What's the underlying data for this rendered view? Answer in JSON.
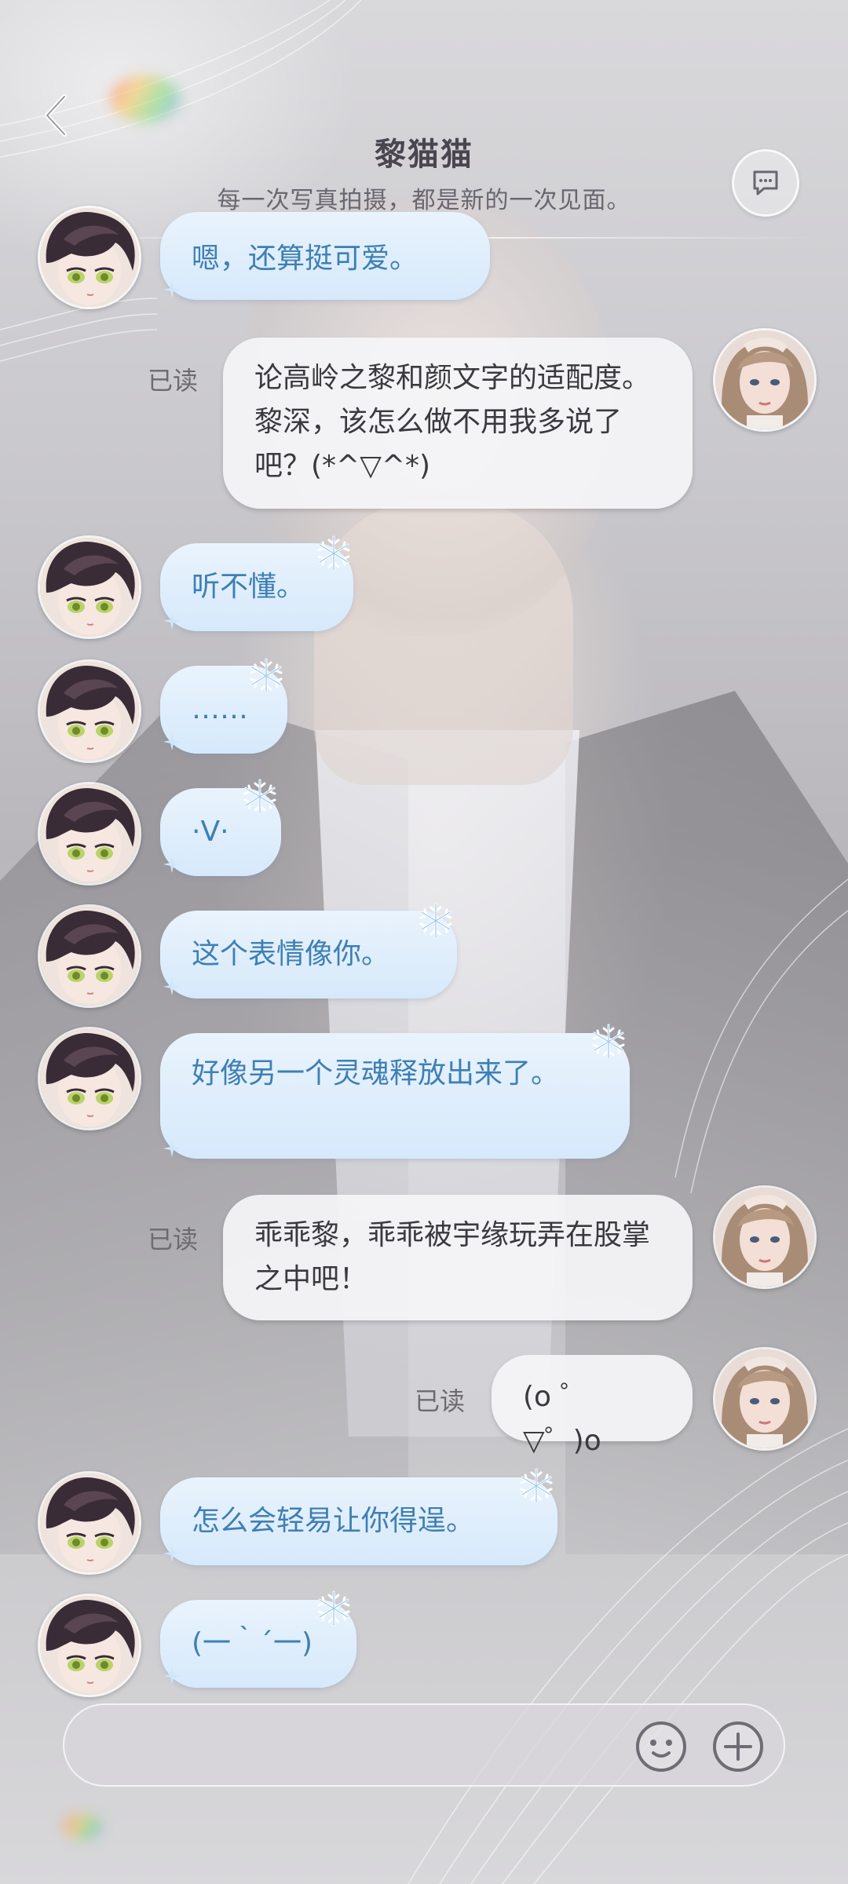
{
  "header": {
    "title": "黎猫猫",
    "subtitle": "每一次写真拍摄，都是新的一次见面。"
  },
  "messages": [
    {
      "side": "in",
      "text": "嗯，还算挺可爱。"
    },
    {
      "side": "out",
      "text": "论高岭之黎和颜文字的适配度。黎深，该怎么做不用我多说了吧？(*^▽^*)",
      "status": "已读"
    },
    {
      "side": "in",
      "text": "听不懂。"
    },
    {
      "side": "in",
      "text": "……"
    },
    {
      "side": "in",
      "text": "·V·"
    },
    {
      "side": "in",
      "text": "这个表情像你。"
    },
    {
      "side": "in",
      "text": "好像另一个灵魂释放出来了。"
    },
    {
      "side": "out",
      "text": "乖乖黎，乖乖被宇缘玩弄在股掌之中吧！",
      "status": "已读"
    },
    {
      "side": "out",
      "text": "(o ゜▽゜)o",
      "status": "已读"
    },
    {
      "side": "in",
      "text": "怎么会轻易让你得逞。"
    },
    {
      "side": "in",
      "text": "(一｀´一)"
    }
  ],
  "input": {
    "value": "",
    "placeholder": ""
  },
  "icons": {
    "back": "back-icon",
    "moments": "chat-bubble-icon",
    "emoji": "emoji-icon",
    "more": "plus-icon"
  },
  "colors": {
    "incoming_text": "#3e7fb5",
    "incoming_bubble": "#d6e9fb",
    "outgoing_bubble": "#f4f4f6",
    "title": "#4a4650"
  }
}
